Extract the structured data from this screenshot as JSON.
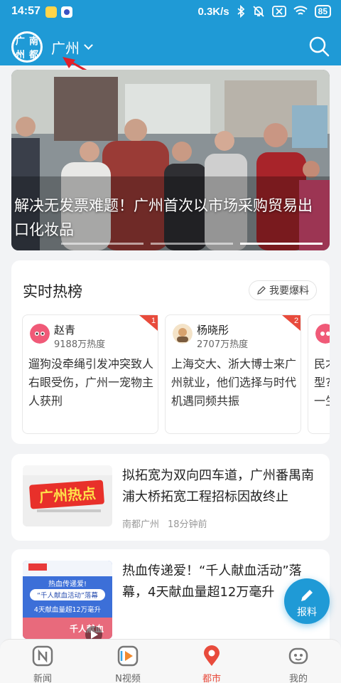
{
  "status_bar": {
    "time": "14:57",
    "net_speed": "0.3K/s",
    "battery": "85"
  },
  "header": {
    "logo_chars": [
      "广",
      "南",
      "州",
      "都"
    ],
    "city": "广州"
  },
  "banner": {
    "title": "解决无发票难题！广州首次以市场采购贸易出口化妆品"
  },
  "hot_list": {
    "title": "实时热榜",
    "report_label": "我要爆料",
    "cards": [
      {
        "rank": "1",
        "user": "赵青",
        "heat": "9188万热度",
        "text": "遛狗没牵绳引发冲突致人右眼受伤，广州一宠物主人获刑"
      },
      {
        "rank": "2",
        "user": "杨晓彤",
        "heat": "2707万热度",
        "text": "上海交大、浙大博士来广州就业，他们选择与时代机遇同频共振"
      },
      {
        "rank": "",
        "user": "",
        "heat": "",
        "text": "民才型?一生"
      }
    ]
  },
  "news": [
    {
      "title": "拟拓宽为双向四车道，广州番禺南浦大桥拓宽工程招标因故终止",
      "source": "南都广州",
      "time": "18分钟前",
      "thumb_text": "广州热点"
    },
    {
      "title": "热血传递爱！“千人献血活动”落幕，4天献血量超12万毫升",
      "thumb_lines": [
        "热血传递爱!",
        "“千人献血活动”落幕",
        "4天献血量超12万毫升",
        "千人献血"
      ]
    }
  ],
  "fab": {
    "label": "报料"
  },
  "bottom_nav": [
    {
      "label": "新闻",
      "icon": "news-icon"
    },
    {
      "label": "N视频",
      "icon": "video-icon"
    },
    {
      "label": "都市",
      "icon": "city-location-icon"
    },
    {
      "label": "我的",
      "icon": "profile-robot-icon"
    }
  ],
  "colors": {
    "primary": "#1f9ad6",
    "active_tab": "#e84b3c",
    "rank_badge": "#e84b3c"
  }
}
